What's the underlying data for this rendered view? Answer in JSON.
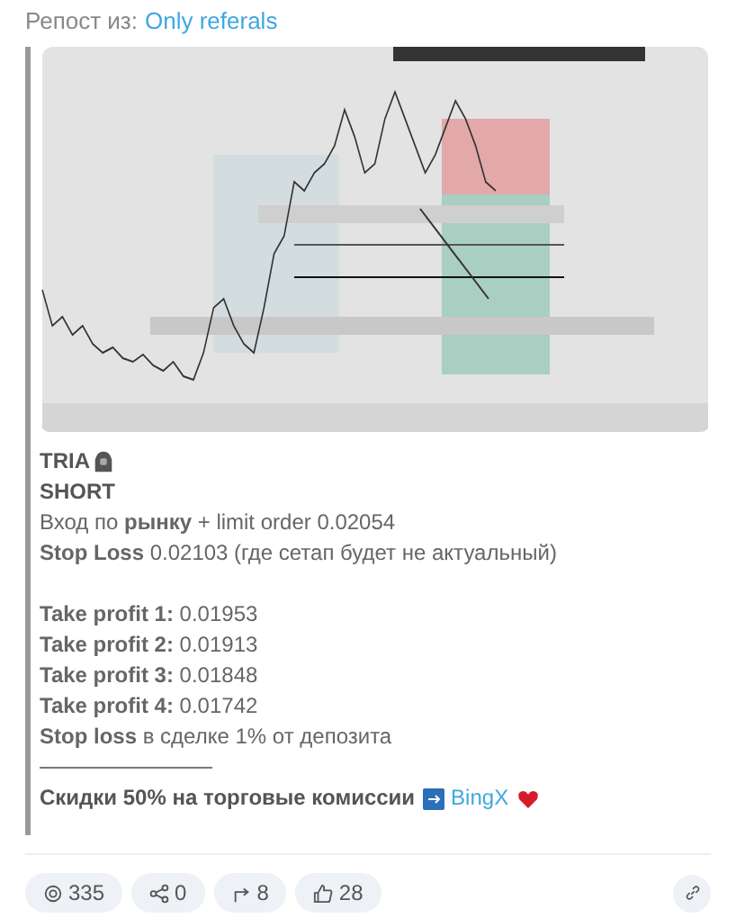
{
  "repost": {
    "label": "Репост из:",
    "source": "Only referals"
  },
  "post": {
    "lines": [
      {
        "kind": "title_icon",
        "text": "TRIA"
      },
      {
        "kind": "title",
        "text": "SHORT"
      },
      {
        "kind": "text",
        "text": "Вход по **рынку** + limit order 0.02054"
      },
      {
        "kind": "text",
        "text": "**Stop Loss** 0.02103 (где сетап будет не актуальный)"
      },
      {
        "kind": "blank"
      },
      {
        "kind": "text",
        "text": "**Take profit 1:** 0.01953"
      },
      {
        "kind": "text",
        "text": "**Take profit 2:** 0.01913"
      },
      {
        "kind": "text",
        "text": "**Take profit 3:** 0.01848"
      },
      {
        "kind": "text",
        "text": "**Take profit 4:** 0.01742"
      },
      {
        "kind": "text",
        "text": "**Stop loss** в сделке 1% от депозита"
      },
      {
        "kind": "rule"
      },
      {
        "kind": "promo",
        "text": "Скидки 50% на торговые комиссии",
        "link": "BingX"
      }
    ]
  },
  "stats": [
    {
      "kind": "views",
      "count": "335"
    },
    {
      "kind": "shares",
      "count": "0"
    },
    {
      "kind": "reposts",
      "count": "8"
    },
    {
      "kind": "likes",
      "count": "28"
    }
  ]
}
